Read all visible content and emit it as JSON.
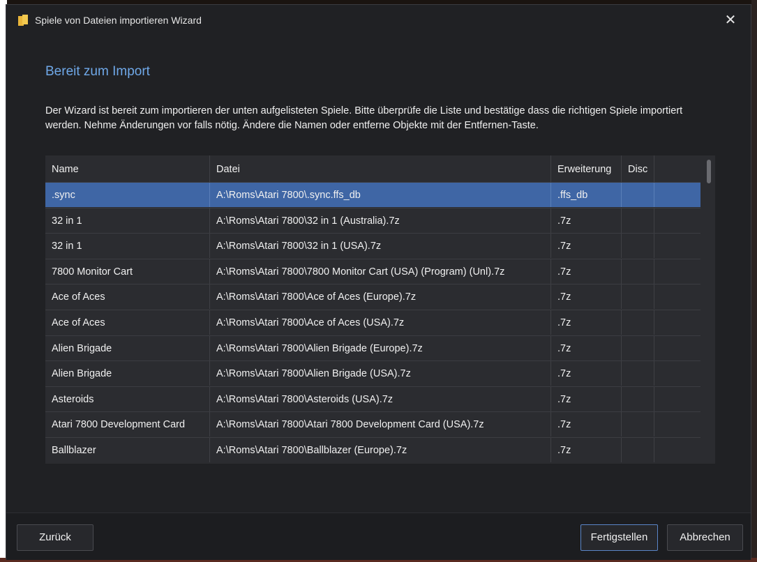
{
  "window": {
    "title": "Spiele von Dateien importieren Wizard",
    "close_glyph": "✕"
  },
  "page": {
    "heading": "Bereit zum Import",
    "description": "Der Wizard ist bereit zum importieren der unten aufgelisteten Spiele. Bitte überprüfe die Liste und bestätige dass die richtigen Spiele importiert werden. Nehme Änderungen vor falls nötig. Ändere die Namen oder entferne Objekte mit der Entfernen-Taste."
  },
  "table": {
    "columns": [
      "Name",
      "Datei",
      "Erweiterung",
      "Disc",
      ""
    ],
    "rows": [
      {
        "name": ".sync",
        "file": "A:\\Roms\\Atari 7800\\.sync.ffs_db",
        "ext": ".ffs_db",
        "disc": ""
      },
      {
        "name": "32 in 1",
        "file": "A:\\Roms\\Atari 7800\\32 in 1 (Australia).7z",
        "ext": ".7z",
        "disc": ""
      },
      {
        "name": "32 in 1",
        "file": "A:\\Roms\\Atari 7800\\32 in 1 (USA).7z",
        "ext": ".7z",
        "disc": ""
      },
      {
        "name": "7800 Monitor Cart",
        "file": "A:\\Roms\\Atari 7800\\7800 Monitor Cart (USA) (Program) (Unl).7z",
        "ext": ".7z",
        "disc": ""
      },
      {
        "name": "Ace of Aces",
        "file": "A:\\Roms\\Atari 7800\\Ace of Aces (Europe).7z",
        "ext": ".7z",
        "disc": ""
      },
      {
        "name": "Ace of Aces",
        "file": "A:\\Roms\\Atari 7800\\Ace of Aces (USA).7z",
        "ext": ".7z",
        "disc": ""
      },
      {
        "name": "Alien Brigade",
        "file": "A:\\Roms\\Atari 7800\\Alien Brigade (Europe).7z",
        "ext": ".7z",
        "disc": ""
      },
      {
        "name": "Alien Brigade",
        "file": "A:\\Roms\\Atari 7800\\Alien Brigade (USA).7z",
        "ext": ".7z",
        "disc": ""
      },
      {
        "name": "Asteroids",
        "file": "A:\\Roms\\Atari 7800\\Asteroids (USA).7z",
        "ext": ".7z",
        "disc": ""
      },
      {
        "name": "Atari 7800 Development Card",
        "file": "A:\\Roms\\Atari 7800\\Atari 7800 Development Card (USA).7z",
        "ext": ".7z",
        "disc": ""
      },
      {
        "name": "Ballblazer",
        "file": "A:\\Roms\\Atari 7800\\Ballblazer (Europe).7z",
        "ext": ".7z",
        "disc": ""
      }
    ],
    "selected_row": 0
  },
  "footer": {
    "back": "Zurück",
    "finish": "Fertigstellen",
    "cancel": "Abbrechen"
  },
  "colors": {
    "dialog_bg": "#202124",
    "accent": "#6fa8e8",
    "selection": "#3f66a5"
  }
}
